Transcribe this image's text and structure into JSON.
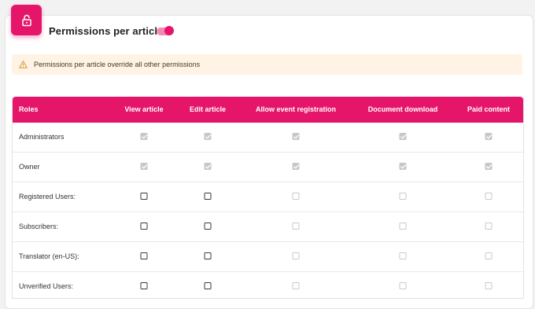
{
  "header": {
    "title": "Permissions per article",
    "lock_icon": "unlock-icon",
    "toggle_on": true,
    "accent_color": "#e5166a"
  },
  "alert": {
    "icon": "warning-icon",
    "message": "Permissions per article override all other permissions",
    "background": "#fff3e5"
  },
  "table": {
    "columns": [
      "Roles",
      "View article",
      "Edit article",
      "Allow event registration",
      "Document download",
      "Paid content"
    ],
    "rows": [
      {
        "role": "Administrators",
        "cells": [
          "checked",
          "checked",
          "checked",
          "checked",
          "checked"
        ]
      },
      {
        "role": "Owner",
        "cells": [
          "checked",
          "checked",
          "checked",
          "checked",
          "checked"
        ]
      },
      {
        "role": "Registered Users:",
        "cells": [
          "active",
          "active",
          "disabled",
          "disabled",
          "disabled"
        ]
      },
      {
        "role": "Subscribers:",
        "cells": [
          "active",
          "active",
          "disabled",
          "disabled",
          "disabled"
        ]
      },
      {
        "role": "Translator (en-US):",
        "cells": [
          "active",
          "active",
          "disabled",
          "disabled",
          "disabled"
        ]
      },
      {
        "role": "Unverified Users:",
        "cells": [
          "active",
          "active",
          "disabled",
          "disabled",
          "disabled"
        ]
      }
    ]
  }
}
